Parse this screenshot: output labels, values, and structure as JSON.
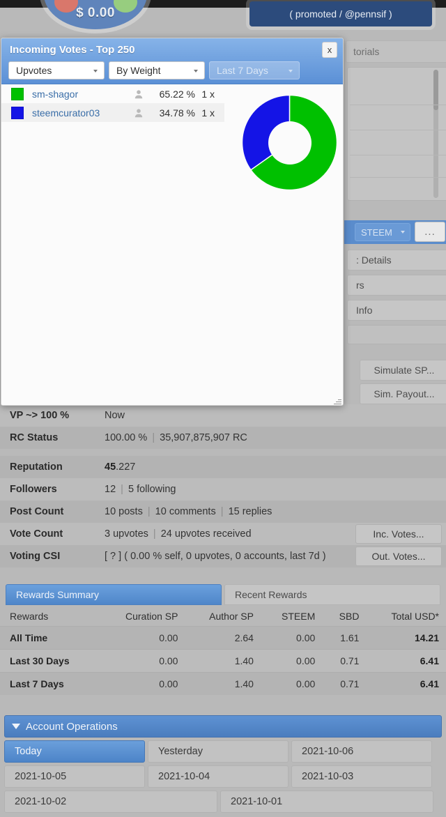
{
  "background": {
    "hero_amount": "$ 0.00",
    "promoted_label": "( promoted / @pennsif )",
    "tutorials_label": "torials",
    "steem_select": "STEEM",
    "dots_button": "...",
    "side_rows": [
      {
        "label": ": Details"
      },
      {
        "label": "rs"
      },
      {
        "label": "Info"
      }
    ],
    "side_buttons": [
      {
        "label": "Simulate SP..."
      },
      {
        "label": "Sim. Payout..."
      }
    ]
  },
  "modal": {
    "title": "Incoming Votes - Top 250",
    "close_label": "x",
    "filters": {
      "type": {
        "value": "Upvotes",
        "enabled": true
      },
      "sort": {
        "value": "By Weight",
        "enabled": true
      },
      "range": {
        "value": "Last 7 Days",
        "enabled": false
      }
    },
    "votes": [
      {
        "color": "#00c000",
        "name": "sm-shagor",
        "percent": "65.22 %",
        "count": "1 x"
      },
      {
        "color": "#1414e6",
        "name": "steemcurator03",
        "percent": "34.78 %",
        "count": "1 x"
      }
    ],
    "chart_data": {
      "type": "pie",
      "title": "Incoming Votes - Top 250",
      "labels": [
        "sm-shagor",
        "steemcurator03"
      ],
      "values": [
        65.22,
        34.78
      ],
      "colors": [
        "#00c000",
        "#1414e6"
      ],
      "unit": "%",
      "donut": true,
      "inner_radius_ratio": 0.45,
      "start_angle_deg": 0,
      "direction": "clockwise",
      "legend": "left-list"
    }
  },
  "info_table": {
    "rows": [
      {
        "label": "VP ~> 100 %",
        "value_html": "Now",
        "button": null
      },
      {
        "label": "RC Status",
        "value_html": "100.00 %|35,907,875,907 RC",
        "button": null
      }
    ],
    "rows2": [
      {
        "label": "Reputation",
        "value_main": "45",
        "value_rest": ".227",
        "button": null
      },
      {
        "label": "Followers",
        "value_html": "12|5 following",
        "button": null
      },
      {
        "label": "Post Count",
        "value_html": "10 posts|10 comments|15 replies",
        "button": null
      },
      {
        "label": "Vote Count",
        "value_html": "3 upvotes|24 upvotes received",
        "button": "Inc. Votes..."
      },
      {
        "label": "Voting CSI",
        "value_html": "[ ? ] ( 0.00 % self, 0 upvotes, 0 accounts, last 7d )",
        "button": "Out. Votes..."
      }
    ]
  },
  "rewards": {
    "tabs": [
      {
        "label": "Rewards Summary",
        "active": true
      },
      {
        "label": "Recent Rewards",
        "active": false
      }
    ],
    "headers": [
      "Rewards",
      "Curation SP",
      "Author SP",
      "STEEM",
      "SBD",
      "Total USD*"
    ],
    "rows": [
      {
        "cells": [
          "All Time",
          "0.00",
          "2.64",
          "0.00",
          "1.61",
          "14.21"
        ]
      },
      {
        "cells": [
          "Last 30 Days",
          "0.00",
          "1.40",
          "0.00",
          "0.71",
          "6.41"
        ]
      },
      {
        "cells": [
          "Last 7 Days",
          "0.00",
          "1.40",
          "0.00",
          "0.71",
          "6.41"
        ]
      }
    ]
  },
  "account_operations": {
    "header": "Account Operations",
    "dates": [
      {
        "label": "Today",
        "active": true,
        "width": "w3"
      },
      {
        "label": "Yesterday",
        "active": false,
        "width": "w3"
      },
      {
        "label": "2021-10-06",
        "active": false,
        "width": "w3"
      },
      {
        "label": "2021-10-05",
        "active": false,
        "width": "w3"
      },
      {
        "label": "2021-10-04",
        "active": false,
        "width": "w3"
      },
      {
        "label": "2021-10-03",
        "active": false,
        "width": "w3"
      },
      {
        "label": "2021-10-02",
        "active": false,
        "width": "w2"
      },
      {
        "label": "2021-10-01",
        "active": false,
        "width": "w2"
      }
    ]
  }
}
